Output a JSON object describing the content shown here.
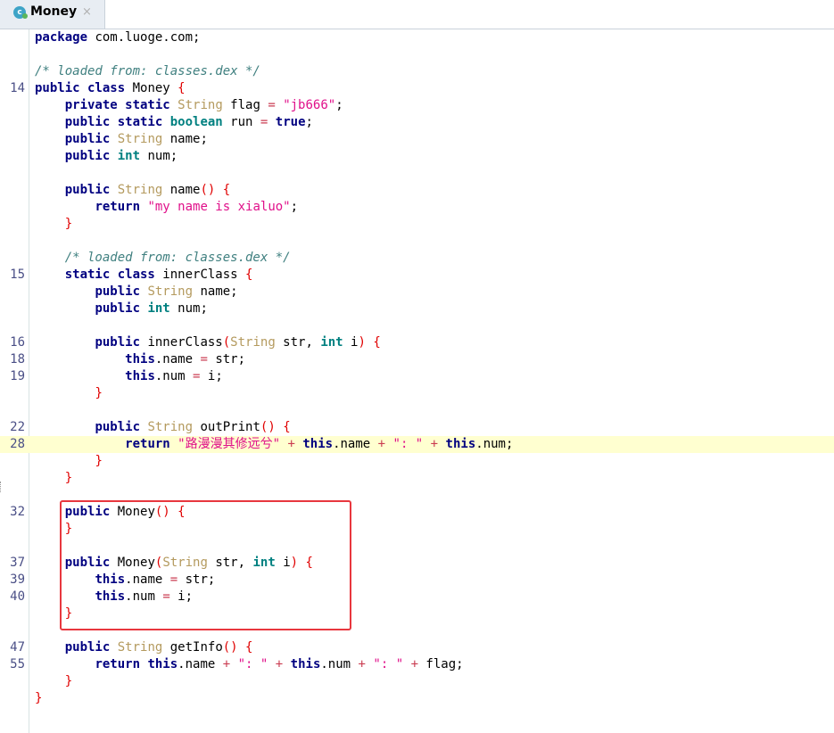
{
  "tab": {
    "icon_letter": "c",
    "title": "Money",
    "close": "×"
  },
  "code_lines": [
    {
      "ln": "",
      "hl": false,
      "toks": [
        [
          "kw",
          "package"
        ],
        [
          "id",
          " com.luoge.com;"
        ]
      ]
    },
    {
      "ln": "",
      "hl": false,
      "toks": []
    },
    {
      "ln": "",
      "hl": false,
      "toks": [
        [
          "cm",
          "/* loaded from: classes.dex */"
        ]
      ]
    },
    {
      "ln": "14",
      "hl": false,
      "toks": [
        [
          "kw",
          "public class"
        ],
        [
          "id",
          " Money "
        ],
        [
          "pn",
          "{"
        ]
      ]
    },
    {
      "ln": "",
      "hl": false,
      "toks": [
        [
          "id",
          "    "
        ],
        [
          "kw",
          "private static"
        ],
        [
          "id",
          " "
        ],
        [
          "ty",
          "String"
        ],
        [
          "id",
          " flag "
        ],
        [
          "op",
          "="
        ],
        [
          "id",
          " "
        ],
        [
          "st",
          "\"jb666\""
        ],
        [
          "id",
          ";"
        ]
      ]
    },
    {
      "ln": "",
      "hl": false,
      "toks": [
        [
          "id",
          "    "
        ],
        [
          "kw",
          "public static"
        ],
        [
          "id",
          " "
        ],
        [
          "kt",
          "boolean"
        ],
        [
          "id",
          " run "
        ],
        [
          "op",
          "="
        ],
        [
          "id",
          " "
        ],
        [
          "kw",
          "true"
        ],
        [
          "id",
          ";"
        ]
      ]
    },
    {
      "ln": "",
      "hl": false,
      "toks": [
        [
          "id",
          "    "
        ],
        [
          "kw",
          "public"
        ],
        [
          "id",
          " "
        ],
        [
          "ty",
          "String"
        ],
        [
          "id",
          " name;"
        ]
      ]
    },
    {
      "ln": "",
      "hl": false,
      "toks": [
        [
          "id",
          "    "
        ],
        [
          "kw",
          "public"
        ],
        [
          "id",
          " "
        ],
        [
          "kt",
          "int"
        ],
        [
          "id",
          " num;"
        ]
      ]
    },
    {
      "ln": "",
      "hl": false,
      "toks": []
    },
    {
      "ln": "",
      "hl": false,
      "toks": [
        [
          "id",
          "    "
        ],
        [
          "kw",
          "public"
        ],
        [
          "id",
          " "
        ],
        [
          "ty",
          "String"
        ],
        [
          "id",
          " name"
        ],
        [
          "pn",
          "()"
        ],
        [
          "id",
          " "
        ],
        [
          "pn",
          "{"
        ]
      ]
    },
    {
      "ln": "",
      "hl": false,
      "toks": [
        [
          "id",
          "        "
        ],
        [
          "kw",
          "return"
        ],
        [
          "id",
          " "
        ],
        [
          "st",
          "\"my name is xialuo\""
        ],
        [
          "id",
          ";"
        ]
      ]
    },
    {
      "ln": "",
      "hl": false,
      "toks": [
        [
          "id",
          "    "
        ],
        [
          "pn",
          "}"
        ]
      ]
    },
    {
      "ln": "",
      "hl": false,
      "toks": []
    },
    {
      "ln": "",
      "hl": false,
      "toks": [
        [
          "id",
          "    "
        ],
        [
          "cm",
          "/* loaded from: classes.dex */"
        ]
      ]
    },
    {
      "ln": "15",
      "hl": false,
      "toks": [
        [
          "id",
          "    "
        ],
        [
          "kw",
          "static class"
        ],
        [
          "id",
          " innerClass "
        ],
        [
          "pn",
          "{"
        ]
      ]
    },
    {
      "ln": "",
      "hl": false,
      "toks": [
        [
          "id",
          "        "
        ],
        [
          "kw",
          "public"
        ],
        [
          "id",
          " "
        ],
        [
          "ty",
          "String"
        ],
        [
          "id",
          " name;"
        ]
      ]
    },
    {
      "ln": "",
      "hl": false,
      "toks": [
        [
          "id",
          "        "
        ],
        [
          "kw",
          "public"
        ],
        [
          "id",
          " "
        ],
        [
          "kt",
          "int"
        ],
        [
          "id",
          " num;"
        ]
      ]
    },
    {
      "ln": "",
      "hl": false,
      "toks": []
    },
    {
      "ln": "16",
      "hl": false,
      "toks": [
        [
          "id",
          "        "
        ],
        [
          "kw",
          "public"
        ],
        [
          "id",
          " innerClass"
        ],
        [
          "pn",
          "("
        ],
        [
          "ty",
          "String"
        ],
        [
          "id",
          " str, "
        ],
        [
          "kt",
          "int"
        ],
        [
          "id",
          " i"
        ],
        [
          "pn",
          ")"
        ],
        [
          "id",
          " "
        ],
        [
          "pn",
          "{"
        ]
      ]
    },
    {
      "ln": "18",
      "hl": false,
      "toks": [
        [
          "id",
          "            "
        ],
        [
          "kw",
          "this"
        ],
        [
          "id",
          ".name "
        ],
        [
          "op",
          "="
        ],
        [
          "id",
          " str;"
        ]
      ]
    },
    {
      "ln": "19",
      "hl": false,
      "toks": [
        [
          "id",
          "            "
        ],
        [
          "kw",
          "this"
        ],
        [
          "id",
          ".num "
        ],
        [
          "op",
          "="
        ],
        [
          "id",
          " i;"
        ]
      ]
    },
    {
      "ln": "",
      "hl": false,
      "toks": [
        [
          "id",
          "        "
        ],
        [
          "pn",
          "}"
        ]
      ]
    },
    {
      "ln": "",
      "hl": false,
      "toks": []
    },
    {
      "ln": "22",
      "hl": false,
      "toks": [
        [
          "id",
          "        "
        ],
        [
          "kw",
          "public"
        ],
        [
          "id",
          " "
        ],
        [
          "ty",
          "String"
        ],
        [
          "id",
          " outPrint"
        ],
        [
          "pn",
          "()"
        ],
        [
          "id",
          " "
        ],
        [
          "pn",
          "{"
        ]
      ]
    },
    {
      "ln": "28",
      "hl": true,
      "toks": [
        [
          "id",
          "            "
        ],
        [
          "kw",
          "return"
        ],
        [
          "id",
          " "
        ],
        [
          "st",
          "\"路漫漫其修远兮\""
        ],
        [
          "id",
          " "
        ],
        [
          "op",
          "+"
        ],
        [
          "id",
          " "
        ],
        [
          "kw",
          "this"
        ],
        [
          "id",
          ".name "
        ],
        [
          "op",
          "+"
        ],
        [
          "id",
          " "
        ],
        [
          "st",
          "\": \""
        ],
        [
          "id",
          " "
        ],
        [
          "op",
          "+"
        ],
        [
          "id",
          " "
        ],
        [
          "kw",
          "this"
        ],
        [
          "id",
          ".num;"
        ]
      ]
    },
    {
      "ln": "",
      "hl": false,
      "toks": [
        [
          "id",
          "        "
        ],
        [
          "pn",
          "}"
        ]
      ]
    },
    {
      "ln": "",
      "hl": false,
      "toks": [
        [
          "id",
          "    "
        ],
        [
          "pn",
          "}"
        ]
      ]
    },
    {
      "ln": "",
      "hl": false,
      "toks": []
    },
    {
      "ln": "32",
      "hl": false,
      "toks": [
        [
          "id",
          "    "
        ],
        [
          "kw",
          "public"
        ],
        [
          "id",
          " Money"
        ],
        [
          "pn",
          "()"
        ],
        [
          "id",
          " "
        ],
        [
          "pn",
          "{"
        ]
      ]
    },
    {
      "ln": "",
      "hl": false,
      "toks": [
        [
          "id",
          "    "
        ],
        [
          "pn",
          "}"
        ]
      ]
    },
    {
      "ln": "",
      "hl": false,
      "toks": []
    },
    {
      "ln": "37",
      "hl": false,
      "toks": [
        [
          "id",
          "    "
        ],
        [
          "kw",
          "public"
        ],
        [
          "id",
          " Money"
        ],
        [
          "pn",
          "("
        ],
        [
          "ty",
          "String"
        ],
        [
          "id",
          " str, "
        ],
        [
          "kt",
          "int"
        ],
        [
          "id",
          " i"
        ],
        [
          "pn",
          ")"
        ],
        [
          "id",
          " "
        ],
        [
          "pn",
          "{"
        ]
      ]
    },
    {
      "ln": "39",
      "hl": false,
      "toks": [
        [
          "id",
          "        "
        ],
        [
          "kw",
          "this"
        ],
        [
          "id",
          ".name "
        ],
        [
          "op",
          "="
        ],
        [
          "id",
          " str;"
        ]
      ]
    },
    {
      "ln": "40",
      "hl": false,
      "toks": [
        [
          "id",
          "        "
        ],
        [
          "kw",
          "this"
        ],
        [
          "id",
          ".num "
        ],
        [
          "op",
          "="
        ],
        [
          "id",
          " i;"
        ]
      ]
    },
    {
      "ln": "",
      "hl": false,
      "toks": [
        [
          "id",
          "    "
        ],
        [
          "pn",
          "}"
        ]
      ]
    },
    {
      "ln": "",
      "hl": false,
      "toks": []
    },
    {
      "ln": "47",
      "hl": false,
      "toks": [
        [
          "id",
          "    "
        ],
        [
          "kw",
          "public"
        ],
        [
          "id",
          " "
        ],
        [
          "ty",
          "String"
        ],
        [
          "id",
          " getInfo"
        ],
        [
          "pn",
          "()"
        ],
        [
          "id",
          " "
        ],
        [
          "pn",
          "{"
        ]
      ]
    },
    {
      "ln": "55",
      "hl": false,
      "toks": [
        [
          "id",
          "        "
        ],
        [
          "kw",
          "return"
        ],
        [
          "id",
          " "
        ],
        [
          "kw",
          "this"
        ],
        [
          "id",
          ".name "
        ],
        [
          "op",
          "+"
        ],
        [
          "id",
          " "
        ],
        [
          "st",
          "\": \""
        ],
        [
          "id",
          " "
        ],
        [
          "op",
          "+"
        ],
        [
          "id",
          " "
        ],
        [
          "kw",
          "this"
        ],
        [
          "id",
          ".num "
        ],
        [
          "op",
          "+"
        ],
        [
          "id",
          " "
        ],
        [
          "st",
          "\": \""
        ],
        [
          "id",
          " "
        ],
        [
          "op",
          "+"
        ],
        [
          "id",
          " flag;"
        ]
      ]
    },
    {
      "ln": "",
      "hl": false,
      "toks": [
        [
          "id",
          "    "
        ],
        [
          "pn",
          "}"
        ]
      ]
    },
    {
      "ln": "",
      "hl": false,
      "toks": [
        [
          "pn",
          "}"
        ]
      ]
    }
  ]
}
